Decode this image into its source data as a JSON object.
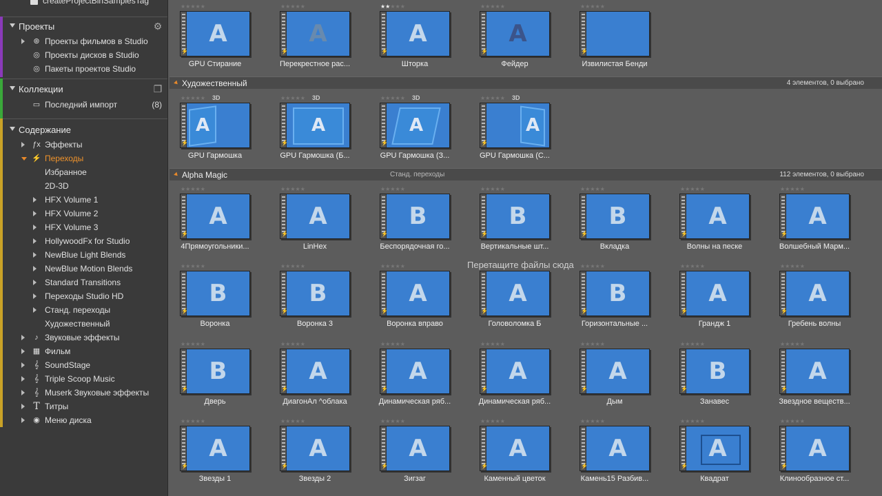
{
  "sidebar": {
    "top_item": "createProjectBinSamplesTag",
    "projects": {
      "title": "Проекты",
      "items": [
        "Проекты фильмов в Studio",
        "Проекты дисков в Studio",
        "Пакеты проектов Studio"
      ]
    },
    "collections": {
      "title": "Коллекции",
      "items": [
        {
          "label": "Последний импорт",
          "count": "(8)"
        }
      ]
    },
    "content": {
      "title": "Содержание",
      "items": [
        {
          "label": "Эффекты",
          "icon": "fx-icon"
        },
        {
          "label": "Переходы",
          "icon": "lightning-icon",
          "active": true
        },
        {
          "label": "Избранное"
        },
        {
          "label": "2D-3D"
        },
        {
          "label": "HFX Volume 1"
        },
        {
          "label": "HFX Volume 2"
        },
        {
          "label": "HFX Volume 3"
        },
        {
          "label": "HollywoodFx for Studio"
        },
        {
          "label": "NewBlue Light Blends"
        },
        {
          "label": "NewBlue Motion Blends"
        },
        {
          "label": "Standard Transitions"
        },
        {
          "label": "Переходы Studio HD"
        },
        {
          "label": "Станд. переходы"
        },
        {
          "label": "Художественный"
        },
        {
          "label": "Звуковые эффекты",
          "icon": "music-note-icon"
        },
        {
          "label": "Фильм",
          "icon": "film-icon"
        },
        {
          "label": "SoundStage",
          "icon": "treble-clef-icon"
        },
        {
          "label": "Triple Scoop Music",
          "icon": "treble-clef-icon"
        },
        {
          "label": "Muserk Звуковые эффекты",
          "icon": "treble-clef-icon"
        },
        {
          "label": "Титры",
          "icon": "title-t-icon"
        },
        {
          "label": "Меню диска",
          "icon": "disc-icon"
        }
      ]
    }
  },
  "groups": {
    "artistic": {
      "title": "Художественный",
      "info": "4 элементов, 0 выбрано"
    },
    "alpha": {
      "title": "Alpha Magic",
      "subtitle": "Станд. переходы",
      "info": "112 элементов, 0 выбрано"
    }
  },
  "top_row": [
    "GPU Стирание",
    "Перекрестное рас...",
    "Шторка",
    "Фейдер",
    "Извилистая Бенди"
  ],
  "artistic_row": [
    "GPU Гармошка",
    "GPU Гармошка (Б...",
    "GPU Гармошка (З...",
    "GPU Гармошка (С..."
  ],
  "tag_3d": "3D",
  "alpha_rows": [
    [
      "4Прямоугольники...",
      "LinHex",
      "Беспорядочная го...",
      "Вертикальные шт...",
      "Вкладка",
      "Волны на песке",
      "Волшебный Марм..."
    ],
    [
      "Воронка",
      "Воронка 3",
      "Воронка вправо",
      "Головоломка Б",
      "Горизонтальные ...",
      "Грандж 1",
      "Гребень волны"
    ],
    [
      "Дверь",
      "ДиагонАл ^облака",
      "Динамическая ряб...",
      "Динамическая ряб...",
      "Дым",
      "Занавес",
      "Звездное веществ..."
    ],
    [
      "Звезды 1",
      "Звезды 2",
      "Зигзаг",
      "Каменный цветок",
      "Камень15 Разбив...",
      "Квадрат",
      "Клинообразное ст..."
    ]
  ],
  "drop_hint": "Перетащите файлы сюда",
  "colors": {
    "accent": "#f0932b",
    "thumb_blue": "#3a7fd0",
    "thumb_orange": "#f29a33"
  }
}
